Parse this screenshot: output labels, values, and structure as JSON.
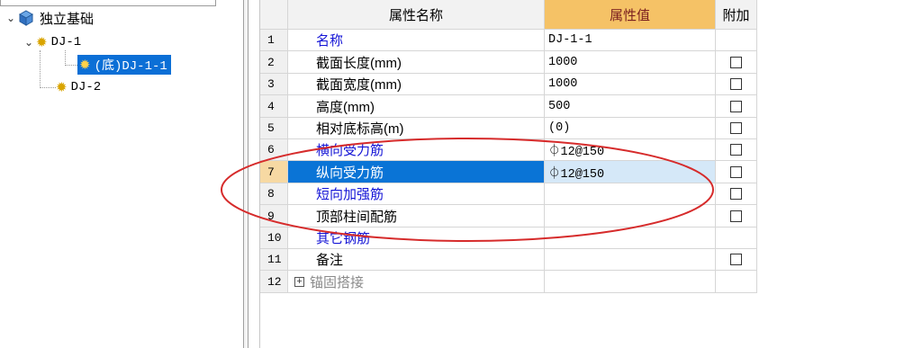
{
  "tree": {
    "root": {
      "label": "独立基础",
      "expanded": true
    },
    "items": [
      {
        "label": "DJ-1",
        "expanded": true,
        "children": [
          {
            "label": "(底)DJ-1-1",
            "selected": true
          }
        ]
      },
      {
        "label": "DJ-2"
      }
    ]
  },
  "grid": {
    "headers": {
      "name": "属性名称",
      "value": "属性值",
      "extra": "附加"
    },
    "rows": [
      {
        "num": "1",
        "name": "名称",
        "value": "DJ-1-1",
        "blue": true,
        "checkbox": false
      },
      {
        "num": "2",
        "name": "截面长度(mm)",
        "value": "1000",
        "blue": false,
        "checkbox": true
      },
      {
        "num": "3",
        "name": "截面宽度(mm)",
        "value": "1000",
        "blue": false,
        "checkbox": true
      },
      {
        "num": "4",
        "name": "高度(mm)",
        "value": "500",
        "blue": false,
        "checkbox": true
      },
      {
        "num": "5",
        "name": "相对底标高(m)",
        "value": "(0)",
        "blue": false,
        "checkbox": true
      },
      {
        "num": "6",
        "name": "横向受力筋",
        "value": "⏀12@150",
        "blue": true,
        "checkbox": true
      },
      {
        "num": "7",
        "name": "纵向受力筋",
        "value": "⏀12@150",
        "blue": true,
        "checkbox": true,
        "selected": true
      },
      {
        "num": "8",
        "name": "短向加强筋",
        "value": "",
        "blue": true,
        "checkbox": true
      },
      {
        "num": "9",
        "name": "顶部柱间配筋",
        "value": "",
        "blue": false,
        "checkbox": true
      },
      {
        "num": "10",
        "name": "其它钢筋",
        "value": "",
        "blue": true,
        "checkbox": false
      },
      {
        "num": "11",
        "name": "备注",
        "value": "",
        "blue": false,
        "checkbox": true
      },
      {
        "num": "12",
        "name": "锚固搭接",
        "value": "",
        "gray": true,
        "checkbox": false,
        "expandable": true,
        "expand_symbol": "+"
      }
    ]
  },
  "colors": {
    "selection_blue": "#0a74d6",
    "header_value_bg": "#f5c266",
    "link_text": "#1414d6",
    "annotation_red": "#d62b2b"
  }
}
